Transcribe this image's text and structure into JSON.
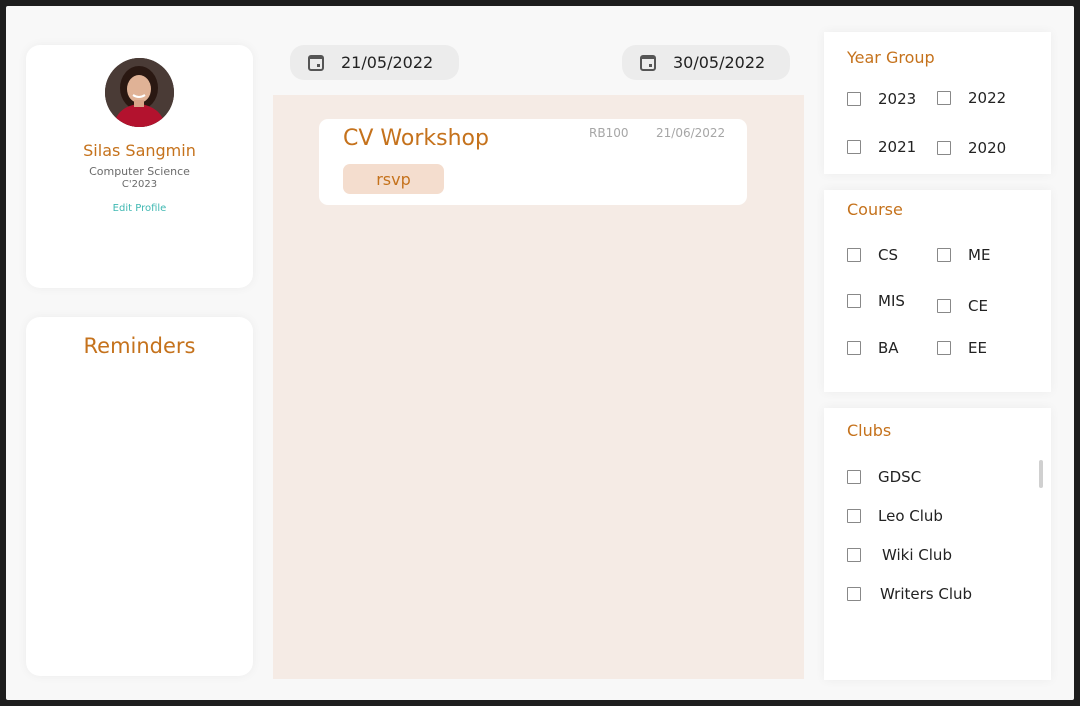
{
  "profile": {
    "name": "Silas Sangmin",
    "course": "Computer Science",
    "year": "C'2023",
    "edit_label": "Edit Profile"
  },
  "reminders": {
    "title": "Reminders"
  },
  "date_range": {
    "start": "21/05/2022",
    "end": "30/05/2022"
  },
  "events": [
    {
      "title": "CV Workshop",
      "room": "RB100",
      "date": "21/06/2022",
      "rsvp_label": "rsvp"
    }
  ],
  "filters": {
    "year_group": {
      "title": "Year Group",
      "options": [
        "2023",
        "2022",
        "2021",
        "2020"
      ]
    },
    "course": {
      "title": "Course",
      "options": [
        "CS",
        "ME",
        "MIS",
        "CE",
        "BA",
        "EE"
      ]
    },
    "clubs": {
      "title": "Clubs",
      "options": [
        "GDSC",
        "Leo Club",
        "Wiki Club",
        "Writers Club"
      ]
    }
  },
  "colors": {
    "accent": "#c5721c",
    "link": "#3fb8b2",
    "panel_bg": "#f5ebe5",
    "rsvp_bg": "#f4ddce"
  }
}
